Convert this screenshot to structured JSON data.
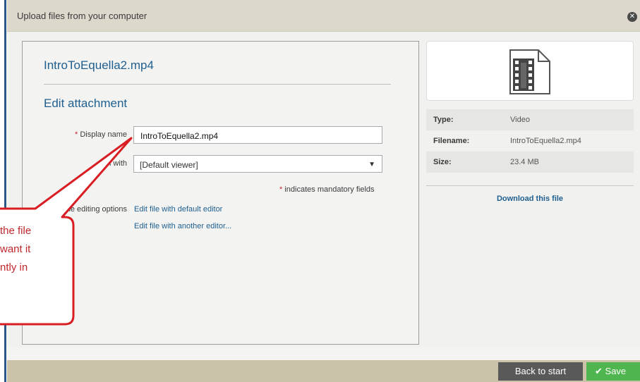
{
  "dialog": {
    "title": "Upload files from your computer",
    "close_icon": "close-circle-icon"
  },
  "main": {
    "file_heading": "IntroToEquella2.mp4",
    "section_heading": "Edit attachment",
    "display_name_label": "Display name",
    "required_marker": "*",
    "display_name_value": "IntroToEquella2.mp4",
    "open_with_label_visible": "en with",
    "viewer_value": "[Default viewer]",
    "mandatory_note": "indicates mandatory fields",
    "editing_label_visible": "le editing options",
    "edit_default_link": "Edit file with default editor",
    "edit_other_link": "Edit file with another editor..."
  },
  "sidebar": {
    "thumbnail_icon": "video-file-icon",
    "rows": [
      {
        "key": "Type:",
        "value": "Video"
      },
      {
        "key": "Filename:",
        "value": "IntroToEquella2.mp4"
      },
      {
        "key": "Size:",
        "value": "23.4 MB"
      }
    ],
    "download_link": "Download this file"
  },
  "footer": {
    "back_label": "Back to start",
    "save_label": "Save",
    "save_icon": "check-icon"
  },
  "callout": {
    "lines": [
      "the file",
      "want it",
      "ntly in"
    ]
  },
  "colors": {
    "accent": "#1f5f8f",
    "required": "#c0282d",
    "save": "#4fb54f",
    "back": "#595959",
    "footer": "#cac2a9",
    "titlebar": "#ddd8cc"
  }
}
